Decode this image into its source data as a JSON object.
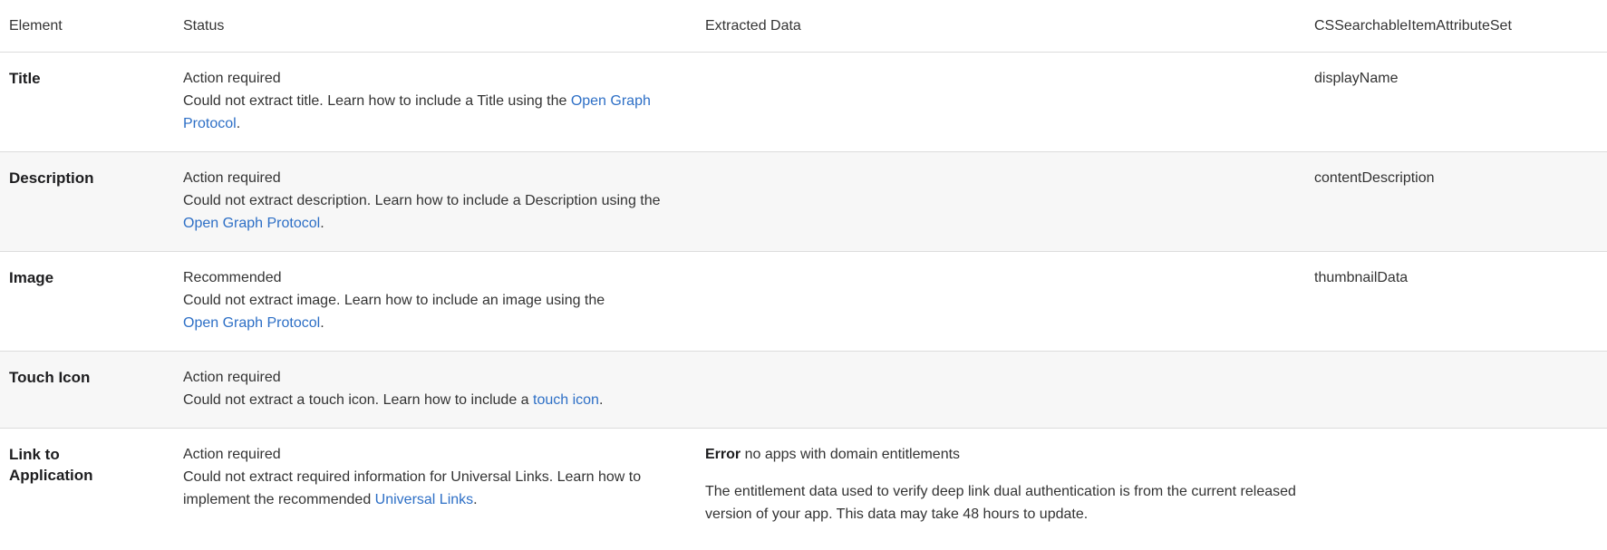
{
  "headers": {
    "element": "Element",
    "status": "Status",
    "extracted": "Extracted Data",
    "attr": "CSSearchableItemAttributeSet"
  },
  "rows": [
    {
      "element": "Title",
      "status": "Action required",
      "message_before": "Could not extract title. Learn how to include a Title using the ",
      "link": "Open Graph Protocol",
      "message_after": ".",
      "attr": "displayName"
    },
    {
      "element": "Description",
      "status": "Action required",
      "message_before": "Could not extract description. Learn how to include a Description using the ",
      "link": "Open Graph Protocol",
      "message_after": ".",
      "attr": "contentDescription"
    },
    {
      "element": "Image",
      "status": "Recommended",
      "message_before": "Could not extract image. Learn how to include an image using the ",
      "link": "Open Graph Protocol",
      "message_after": ".",
      "attr": "thumbnailData"
    },
    {
      "element": "Touch Icon",
      "status": "Action required",
      "message_before": "Could not extract a touch icon. Learn how to include a ",
      "link": "touch icon",
      "message_after": "."
    },
    {
      "element": "Link to Application",
      "status": "Action required",
      "message_before": "Could not extract required information for Universal Links. Learn how to implement the recommended ",
      "link": "Universal Links",
      "message_after": ".",
      "error_label": "Error",
      "error_text": "no apps with domain entitlements",
      "error_description": "The entitlement data used to verify deep link dual authentication is from the current released version of your app. This data may take 48 hours to update."
    }
  ],
  "colors": {
    "link": "#2d6fc6",
    "row_shade": "#f7f7f7",
    "divider": "#dcdcdc"
  }
}
